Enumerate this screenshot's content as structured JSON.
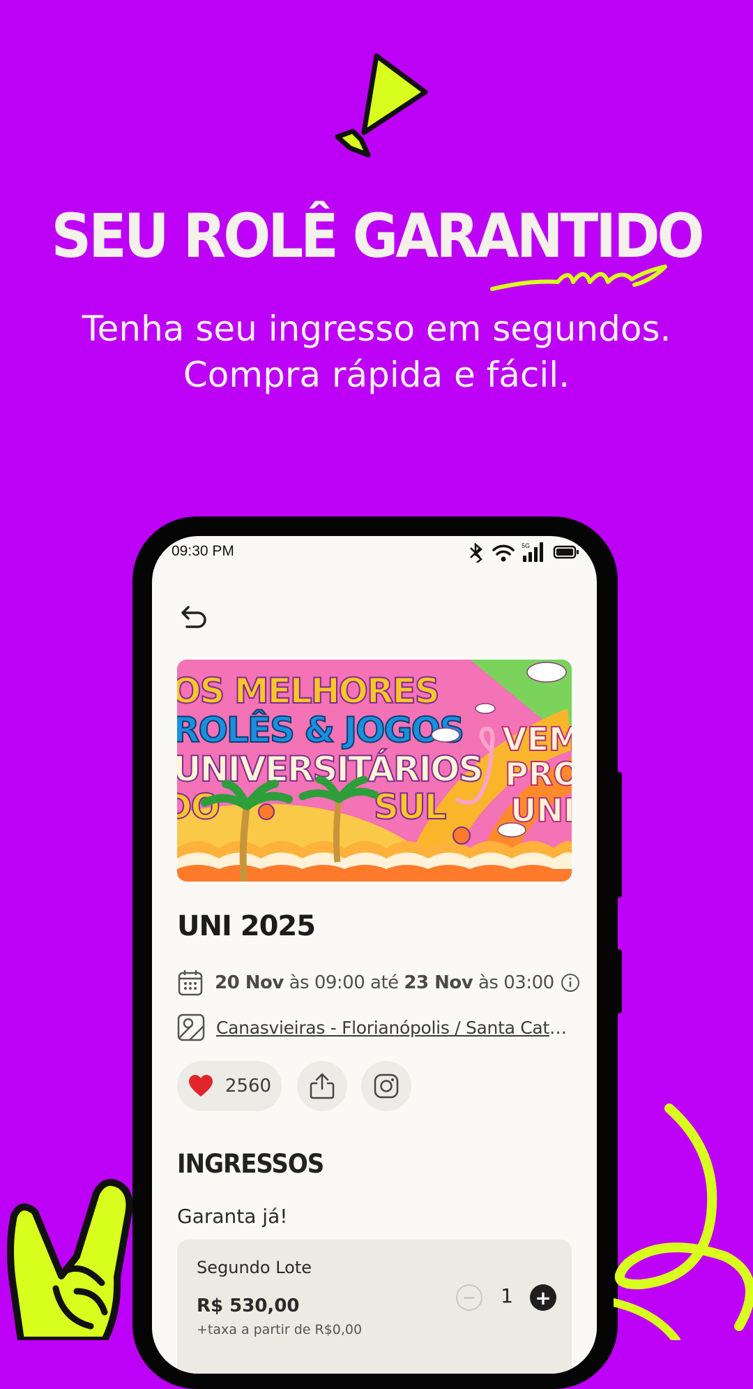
{
  "promo": {
    "headline": "SEU ROLÊ GARANTIDO",
    "subtitle_line1": "Tenha seu ingresso em segundos.",
    "subtitle_line2": "Compra rápida e fácil."
  },
  "status_bar": {
    "time": "09:30 PM",
    "network": "5G"
  },
  "banner": {
    "line1": "OS MELHORES",
    "line2": "ROLÊS & JOGOS",
    "line3": "UNIVERSITÁRIOS",
    "line4a": "DO",
    "line4b": "SUL",
    "tag1": "VEM",
    "tag2": "PRO",
    "tag3": "UNI"
  },
  "event": {
    "title": "UNI 2025",
    "date_start": "20 Nov",
    "date_sep1": "às 09:00 até",
    "date_end": "23 Nov",
    "date_sep2": "às 03:00",
    "location": "Canasvieiras - Florianópolis / Santa Cata...",
    "likes": "2560"
  },
  "tickets": {
    "title": "INGRESSOS",
    "subtitle": "Garanta já!",
    "lot": {
      "name": "Segundo Lote",
      "price": "R$ 530,00",
      "fee": "+taxa a partir de R$0,00",
      "quantity": "1"
    }
  },
  "icons": [
    "exclamation-icon",
    "back-arrow-icon",
    "calendar-icon",
    "info-icon",
    "map-pin-icon",
    "heart-icon",
    "share-icon",
    "instagram-icon",
    "minus-icon",
    "plus-icon",
    "bluetooth-icon",
    "wifi-icon",
    "signal-icon",
    "battery-icon"
  ],
  "colors": {
    "background": "#BD00F6",
    "accent_lime": "#D8FF1E",
    "screen_bg": "#FAF9F5",
    "heart": "#E0262B"
  }
}
